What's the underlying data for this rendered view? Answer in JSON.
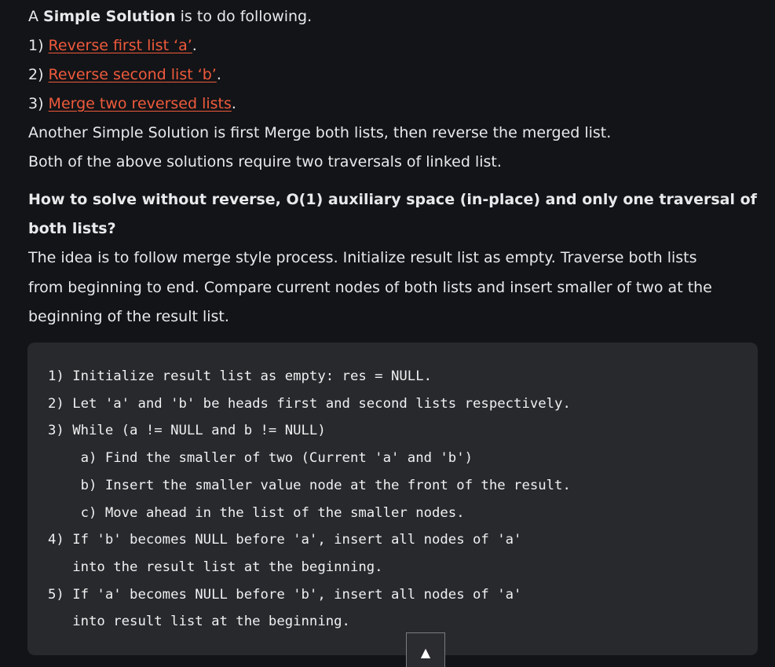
{
  "intro": {
    "prefix": "A ",
    "bold": "Simple Solution",
    "suffix": " is to do following."
  },
  "steps": [
    {
      "num": "1) ",
      "link": "Reverse first list ‘a’",
      "end": "."
    },
    {
      "num": "2) ",
      "link": "Reverse second list ‘b’",
      "end": "."
    },
    {
      "num": "3) ",
      "link": "Merge two reversed lists",
      "end": "."
    }
  ],
  "another": "Another Simple Solution is first Merge both lists, then reverse the merged list.",
  "both": "Both of the above solutions require two traversals of linked list.",
  "heading": {
    "line1": "How to solve without reverse, O(1) auxiliary space (in-place) and only one traversal of",
    "line2": "both lists?"
  },
  "idea": {
    "line1": "The idea is to follow merge style process. Initialize result list as empty. Traverse both lists",
    "line2": "from beginning to end. Compare current nodes of both lists and insert smaller of two at the",
    "line3": "beginning of the result list."
  },
  "code": [
    "1) Initialize result list as empty: res = NULL.",
    "2) Let 'a' and 'b' be heads first and second lists respectively.",
    "3) While (a != NULL and b != NULL)",
    "    a) Find the smaller of two (Current 'a' and 'b')",
    "    b) Insert the smaller value node at the front of the result.",
    "    c) Move ahead in the list of the smaller nodes.",
    "4) If 'b' becomes NULL before 'a', insert all nodes of 'a' ",
    "   into the result list at the beginning.",
    "5) If 'a' becomes NULL before 'b', insert all nodes of 'a' ",
    "   into result list at the beginning."
  ],
  "scroll_top": {
    "glyph": "▲",
    "icon": "arrow-up-icon"
  },
  "colors": {
    "background": "#131417",
    "link": "#ef5a3c",
    "code_bg": "#27292d"
  }
}
